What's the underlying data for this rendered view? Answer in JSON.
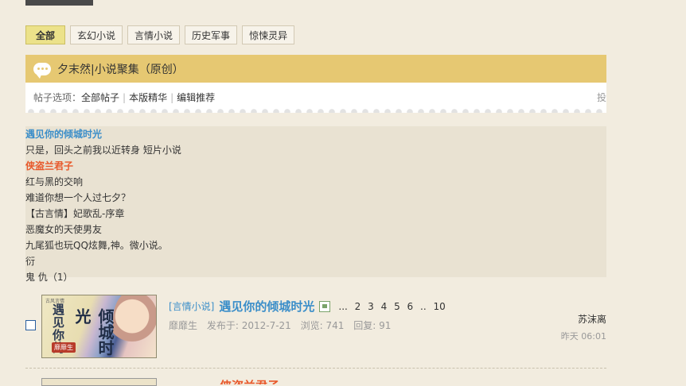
{
  "filters": [
    "全部",
    "玄幻小说",
    "言情小说",
    "历史军事",
    "惊悚灵异"
  ],
  "forum": {
    "title": "夕末然|小说聚集（原创）"
  },
  "options": {
    "prefix": "帖子选项：",
    "links": [
      "全部帖子",
      "本版精华",
      "编辑推荐"
    ],
    "truncated": "投"
  },
  "recommend_list": [
    "遇见你的倾城时光",
    "只是，回头之前我以近转身 短片小说",
    "侠盗兰君子",
    "红与黑的交响",
    "难道你想一个人过七夕？",
    "【古言情】妃歌乱-序章",
    "恶魔女的天使男友",
    "九尾狐也玩QQ炫舞,神。微小说。",
    "衍",
    "鬼 仇（1）"
  ],
  "thread": {
    "category": "[言情小说]",
    "title": "遇见你的倾城时光",
    "pages": [
      "...",
      "2",
      "3",
      "4",
      "5",
      "6",
      "..",
      "10"
    ],
    "author": "靡靡生",
    "posted": "发布于: 2012-7-21",
    "views": "浏览: 741",
    "replies": "回复: 91",
    "last_poster": "苏沫离",
    "last_time": "昨天 06:01",
    "cover": {
      "small_top": "古风言情",
      "text_a": "遇见你的",
      "text_b": "倾城时光",
      "tag": "靡靡生"
    }
  },
  "next_thread": {
    "title": "侠盗兰君子"
  },
  "colors": {
    "background": "#f2ecdf",
    "header_bar": "#e6c872",
    "link_blue": "#3b8ec9",
    "highlight_red": "#e8582a",
    "active_filter": "#ece28a"
  }
}
